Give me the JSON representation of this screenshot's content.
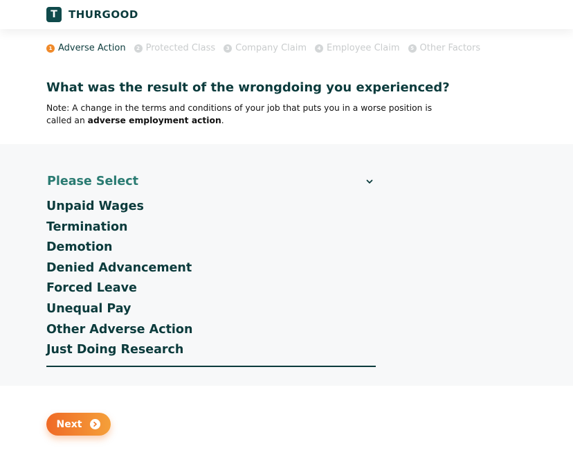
{
  "header": {
    "logo_mark": "T",
    "brand": "THURGOOD"
  },
  "steps": [
    {
      "num": "1",
      "label": "Adverse Action",
      "active": true
    },
    {
      "num": "2",
      "label": "Protected Class",
      "active": false
    },
    {
      "num": "3",
      "label": "Company Claim",
      "active": false
    },
    {
      "num": "4",
      "label": "Employee Claim",
      "active": false
    },
    {
      "num": "5",
      "label": "Other Factors",
      "active": false
    }
  ],
  "question": {
    "title": "What was the result of the wrongdoing you experienced?",
    "note_prefix": "Note: A change in the terms and conditions of your job that puts you in a worse position is called an ",
    "note_bold": "adverse employment action",
    "note_suffix": "."
  },
  "select": {
    "placeholder": "Please Select",
    "options": [
      "Unpaid Wages",
      "Termination",
      "Demotion",
      "Denied Advancement",
      "Forced Leave",
      "Unequal Pay",
      "Other Adverse Action",
      "Just Doing Research"
    ]
  },
  "next_button": {
    "label": "Next"
  },
  "colors": {
    "brand_dark": "#0b3b3c",
    "accent_orange": "#f08a2a",
    "placeholder_teal": "#2a7b72",
    "panel_bg": "#f7f8f9"
  }
}
